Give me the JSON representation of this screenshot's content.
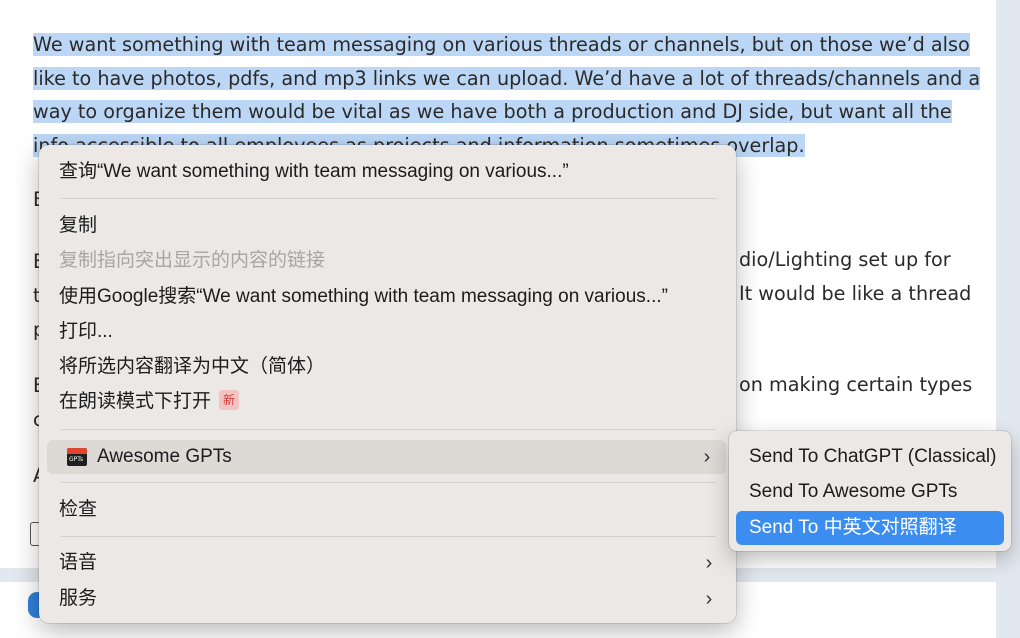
{
  "article": {
    "selected_paragraph": "We want something with team messaging on various threads or channels, but on those we’d also like to have photos, pdfs, and mp3 links we can upload. We’d have a lot of threads/channels and a way to organize them would be vital as we have both a production and DJ side, but want all the info accessible to all employees as projects and information sometimes overlap.",
    "fragments": {
      "left_e1": "E",
      "left_e2": "E",
      "left_t": "t",
      "left_p": "p",
      "left_e3": "E",
      "left_c": "c",
      "left_a": "A",
      "right_1": "dio/Lighting set up for",
      "right_2": "It would be like a thread",
      "right_3": "on making certain types"
    }
  },
  "context_menu": {
    "lookup": "查询“We want something with team messaging on various...”",
    "copy": "复制",
    "copy_link_to_highlight": "复制指向突出显示的内容的链接",
    "google_search": "使用Google搜索“We want something with team messaging on various...”",
    "print": "打印...",
    "translate": "将所选内容翻译为中文（简体）",
    "reader_mode": "在朗读模式下打开",
    "new_badge": "新",
    "extension": "Awesome GPTs",
    "icon_text": "GPTs",
    "inspect": "检查",
    "speech": "语音",
    "services": "服务",
    "chevron": "›"
  },
  "submenu": {
    "items": [
      "Send To ChatGPT (Classical)",
      "Send To Awesome GPTs",
      "Send To 中英文对照翻译"
    ]
  },
  "colors": {
    "selection": "#bcd7f6",
    "menu_bg": "#ece8e5",
    "submenu_active": "#3c8df0",
    "new_badge_text": "#d03c3c"
  }
}
